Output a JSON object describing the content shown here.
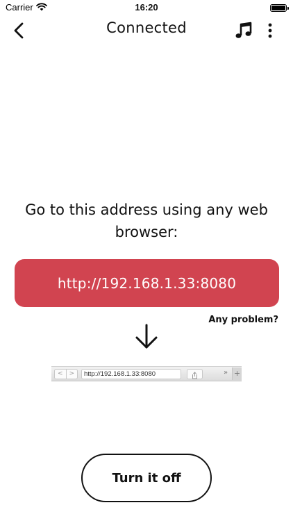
{
  "status_bar": {
    "carrier": "Carrier",
    "time": "16:20",
    "battery_level": 1.0
  },
  "nav_bar": {
    "title": "Connected",
    "back_icon": "chevron-left-icon",
    "music_icon": "music-note-icon",
    "more_icon": "more-vertical-icon"
  },
  "main": {
    "instruction": "Go to this address using any web browser:",
    "address": "http://192.168.1.33:8080",
    "address_button_color": "#d14450",
    "problem_link": "Any problem?",
    "arrow_icon": "arrow-down-icon"
  },
  "browser_illustration": {
    "url": "http://192.168.1.33:8080",
    "back_glyph": "<",
    "forward_glyph": ">",
    "overflow_glyph": "»",
    "new_tab_glyph": "+"
  },
  "footer": {
    "turn_off_label": "Turn it off"
  }
}
